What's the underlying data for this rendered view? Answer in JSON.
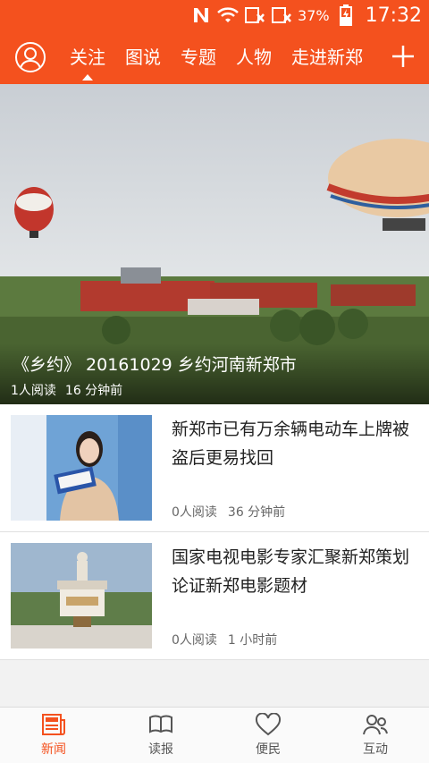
{
  "status": {
    "carrier_icon": "n-notification-icon",
    "battery_percent": "37%",
    "time": "17:32"
  },
  "nav": {
    "tabs": [
      {
        "label": "关注",
        "active": true
      },
      {
        "label": "图说"
      },
      {
        "label": "专题"
      },
      {
        "label": "人物"
      },
      {
        "label": "走进新郑"
      }
    ]
  },
  "hero": {
    "title": "《乡约》 20161029 乡约河南新郑市",
    "reads": "1人阅读",
    "time": "16 分钟前"
  },
  "articles": [
    {
      "title": "新郑市已有万余辆电动车上牌被盗后更易找回",
      "reads": "0人阅读",
      "time": "36 分钟前"
    },
    {
      "title": "国家电视电影专家汇聚新郑策划论证新郑电影题材",
      "reads": "0人阅读",
      "time": "1 小时前"
    }
  ],
  "tabbar": [
    {
      "label": "新闻",
      "active": true
    },
    {
      "label": "读报"
    },
    {
      "label": "便民"
    },
    {
      "label": "互动"
    }
  ],
  "colors": {
    "accent": "#f4511e"
  }
}
